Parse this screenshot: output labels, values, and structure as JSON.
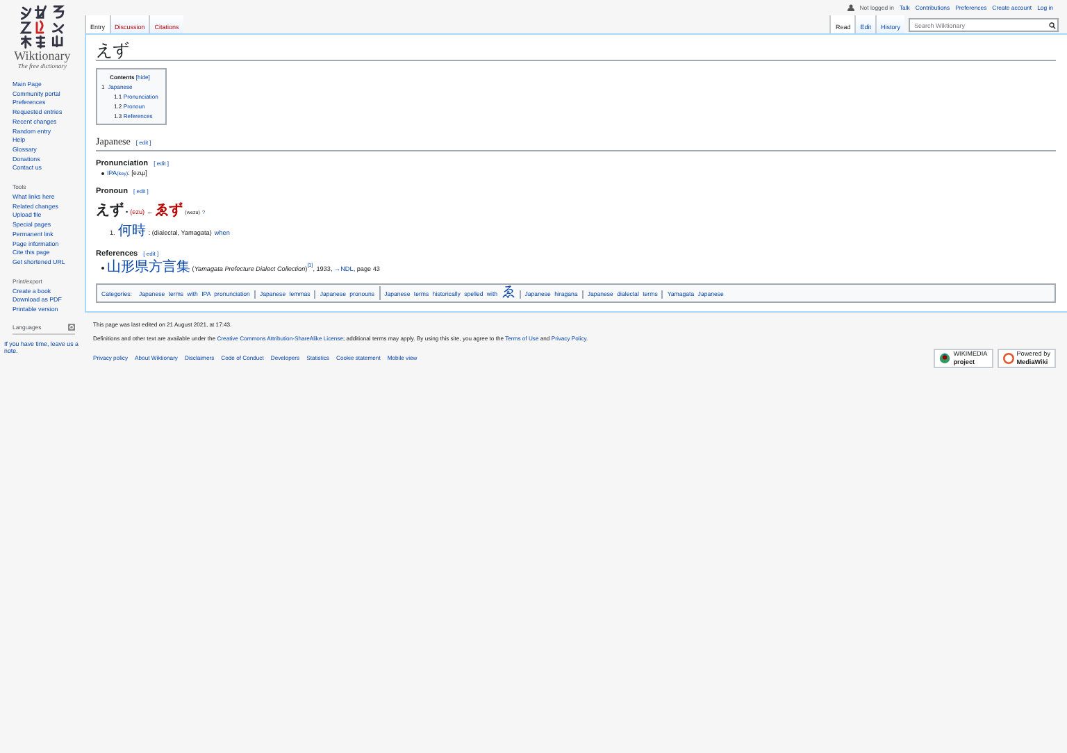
{
  "sidebar": {
    "site_name": "Wiktionary",
    "tagline": "The free dictionary",
    "navigation": [
      "Main Page",
      "Community portal",
      "Preferences",
      "Requested entries",
      "Recent changes",
      "Random entry",
      "Help",
      "Glossary",
      "Donations",
      "Contact us"
    ],
    "tools": {
      "heading": "Tools",
      "items": [
        "What links here",
        "Related changes",
        "Upload file",
        "Special pages",
        "Permanent link",
        "Page information",
        "Cite this page",
        "Get shortened URL"
      ]
    },
    "print_export": {
      "heading": "Print/export",
      "items": [
        "Create a book",
        "Download as PDF",
        "Printable version"
      ]
    },
    "languages": {
      "heading": "Languages",
      "note": "If you have time, leave us a note."
    }
  },
  "personal_tools": {
    "status": "Not logged in",
    "links": [
      "Talk",
      "Contributions",
      "Preferences",
      "Create account",
      "Log in"
    ]
  },
  "namespace_tabs": [
    {
      "label": "Entry",
      "selected": true,
      "missing": false
    },
    {
      "label": "Discussion",
      "selected": false,
      "missing": true
    },
    {
      "label": "Citations",
      "selected": false,
      "missing": true
    }
  ],
  "view_tabs": [
    {
      "label": "Read",
      "selected": true
    },
    {
      "label": "Edit",
      "selected": false
    },
    {
      "label": "History",
      "selected": false
    }
  ],
  "search": {
    "placeholder": "Search Wiktionary"
  },
  "page_title": "えず",
  "toc": {
    "title": "Contents",
    "toggle": "[hide]",
    "items": [
      {
        "number": "1",
        "label": "Japanese",
        "children": [
          {
            "number": "1.1",
            "label": "Pronunciation"
          },
          {
            "number": "1.2",
            "label": "Pronoun"
          },
          {
            "number": "1.3",
            "label": "References"
          }
        ]
      }
    ]
  },
  "language_heading": {
    "title": "Japanese",
    "edit": "[ edit ]"
  },
  "pronunciation": {
    "title": "Pronunciation",
    "edit": "[ edit ]",
    "ipa_link": "IPA",
    "key": "(key)",
    "value": ": [ezɯ̟]"
  },
  "pronoun": {
    "title": "Pronoun",
    "edit": "[ edit ]",
    "headword": "えず",
    "separator": "•",
    "romaji": "(ezu)",
    "arrow": "←",
    "historical": "ゑず",
    "historical_romaji": "(wezu)",
    "note": "?",
    "definitions": [
      {
        "number": "1.",
        "term": "何時",
        "labels": ": (dialectal, Yamagata)",
        "gloss": "when"
      }
    ]
  },
  "references": {
    "title": "References",
    "edit": "[ edit ]",
    "items": [
      [
        {
          "kind": "link",
          "text": "山形県方言集"
        },
        {
          "kind": "text",
          "text": " (*Yamagata Prefecture Dialect Collection*)"
        },
        {
          "kind": "sup",
          "text": "[1]"
        },
        {
          "kind": "text",
          "text": ", 1933, "
        },
        {
          "kind": "link",
          "text": "→NDL"
        },
        {
          "kind": "text",
          "text": ", page 43"
        }
      ]
    ]
  },
  "categories": {
    "label": "Categories",
    "colon": ":",
    "items": [
      "Japanese terms with IPA pronunciation",
      "Japanese lemmas",
      "Japanese pronouns",
      "Japanese terms historically spelled with ゑ",
      "Japanese hiragana",
      "Japanese dialectal terms",
      "Yamagata Japanese"
    ]
  },
  "footer": {
    "last_edited": "This page was last edited on 21 August 2021, at 17:43.",
    "license": [
      {
        "kind": "text",
        "text": "Definitions and other text are available under the "
      },
      {
        "kind": "link",
        "text": "Creative Commons Attribution-ShareAlike License"
      },
      {
        "kind": "text",
        "text": "; additional terms may apply. By using this site, you agree to the "
      },
      {
        "kind": "link",
        "text": "Terms of Use"
      },
      {
        "kind": "text",
        "text": " and "
      },
      {
        "kind": "link",
        "text": "Privacy Policy"
      },
      {
        "kind": "text",
        "text": "."
      }
    ],
    "links": [
      "Privacy policy",
      "About Wiktionary",
      "Disclaimers",
      "Code of Conduct",
      "Developers",
      "Statistics",
      "Cookie statement",
      "Mobile view"
    ],
    "badges": [
      {
        "kind": "wikimedia",
        "top": "WIKIMEDIA",
        "bottom": "project"
      },
      {
        "kind": "mediawiki",
        "top": "Powered by",
        "bottom": "MediaWiki"
      }
    ]
  }
}
